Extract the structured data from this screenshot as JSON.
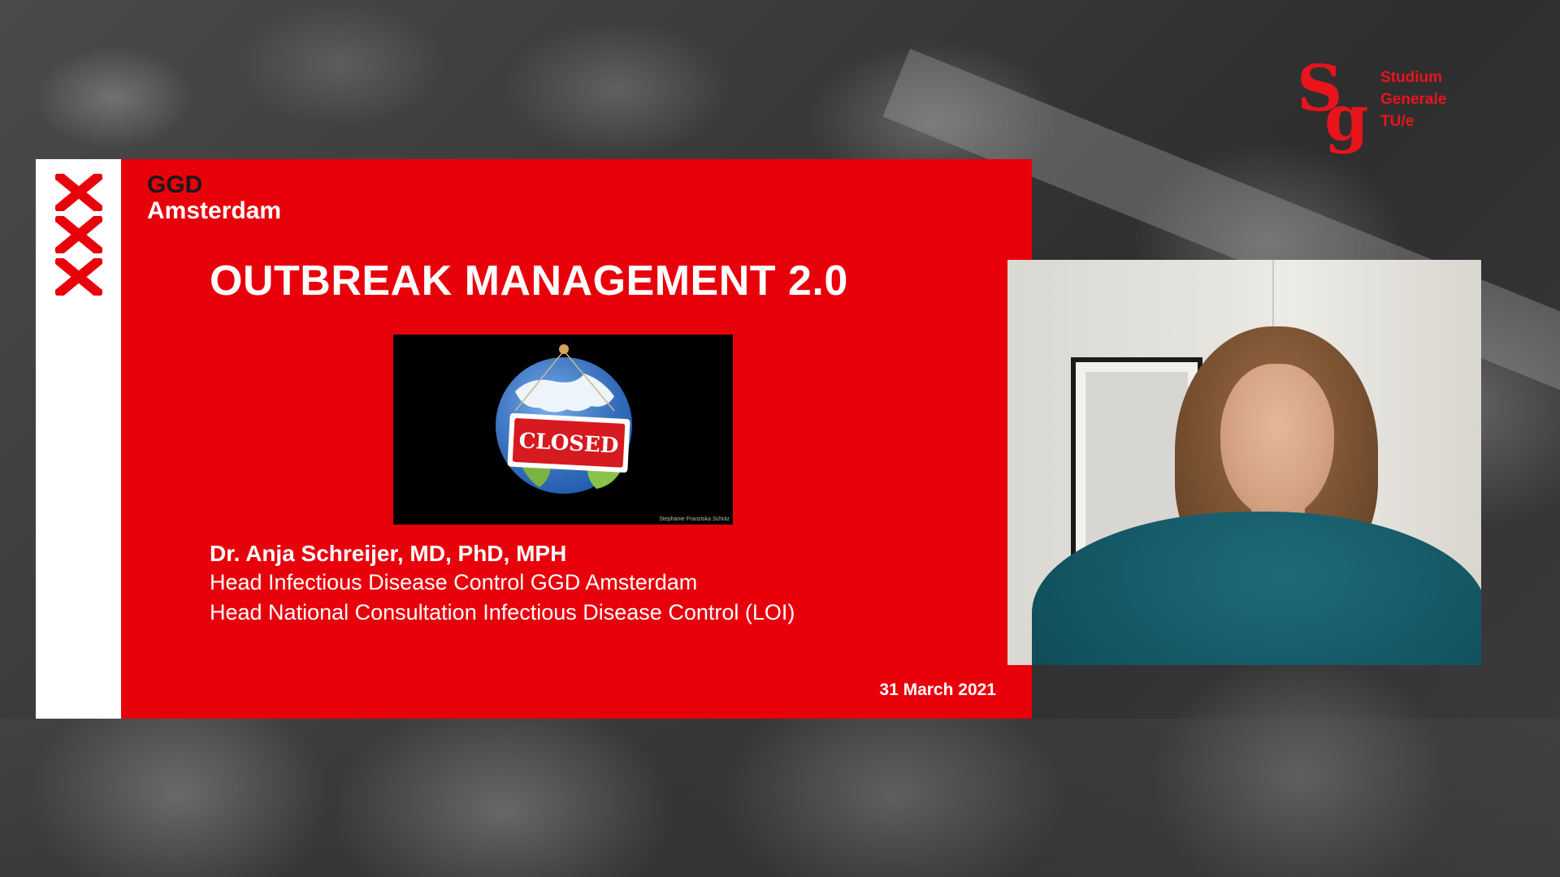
{
  "branding": {
    "studium_generale": {
      "lines": [
        "Studium",
        "Generale",
        "TU/e"
      ]
    }
  },
  "slide": {
    "org": {
      "line1": "GGD",
      "line2": "Amsterdam"
    },
    "title": "OUTBREAK MANAGEMENT 2.0",
    "image": {
      "sign_text": "CLOSED",
      "credit": "Stephanie Franziska Scholz"
    },
    "speaker": {
      "name": "Dr. Anja Schreijer, MD, PhD, MPH",
      "role1": "Head Infectious Disease Control GGD Amsterdam",
      "role2": "Head National Consultation Infectious Disease Control (LOI)"
    },
    "date": "31 March 2021"
  },
  "colors": {
    "slide_red": "#e8000b",
    "logo_red": "#e8141c",
    "background": "#3a3a3a"
  },
  "icons": {
    "city_crosses": "amsterdam-xxx-icon",
    "sg_logo": "studium-generale-logo"
  }
}
